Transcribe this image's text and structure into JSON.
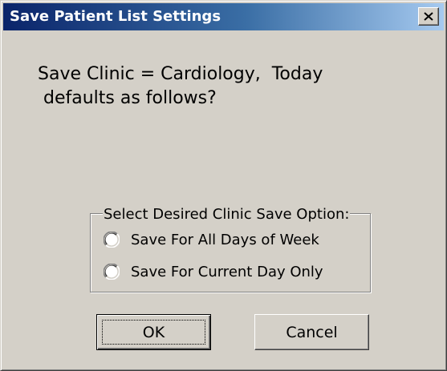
{
  "dialog": {
    "title": "Save Patient List Settings",
    "close_icon": "close-x-icon",
    "message_line1": "Save Clinic = Cardiology,  Today",
    "message_line2": " defaults as follows?"
  },
  "option_group": {
    "legend": "Select Desired Clinic Save Option:",
    "options": [
      {
        "label": "Save For All Days of Week",
        "selected": false
      },
      {
        "label": "Save For Current Day Only",
        "selected": false
      }
    ]
  },
  "buttons": {
    "ok_label": "OK",
    "cancel_label": "Cancel"
  },
  "colors": {
    "title_gradient_start": "#0a246a",
    "title_gradient_end": "#a6caf0",
    "face": "#d4d0c8"
  }
}
